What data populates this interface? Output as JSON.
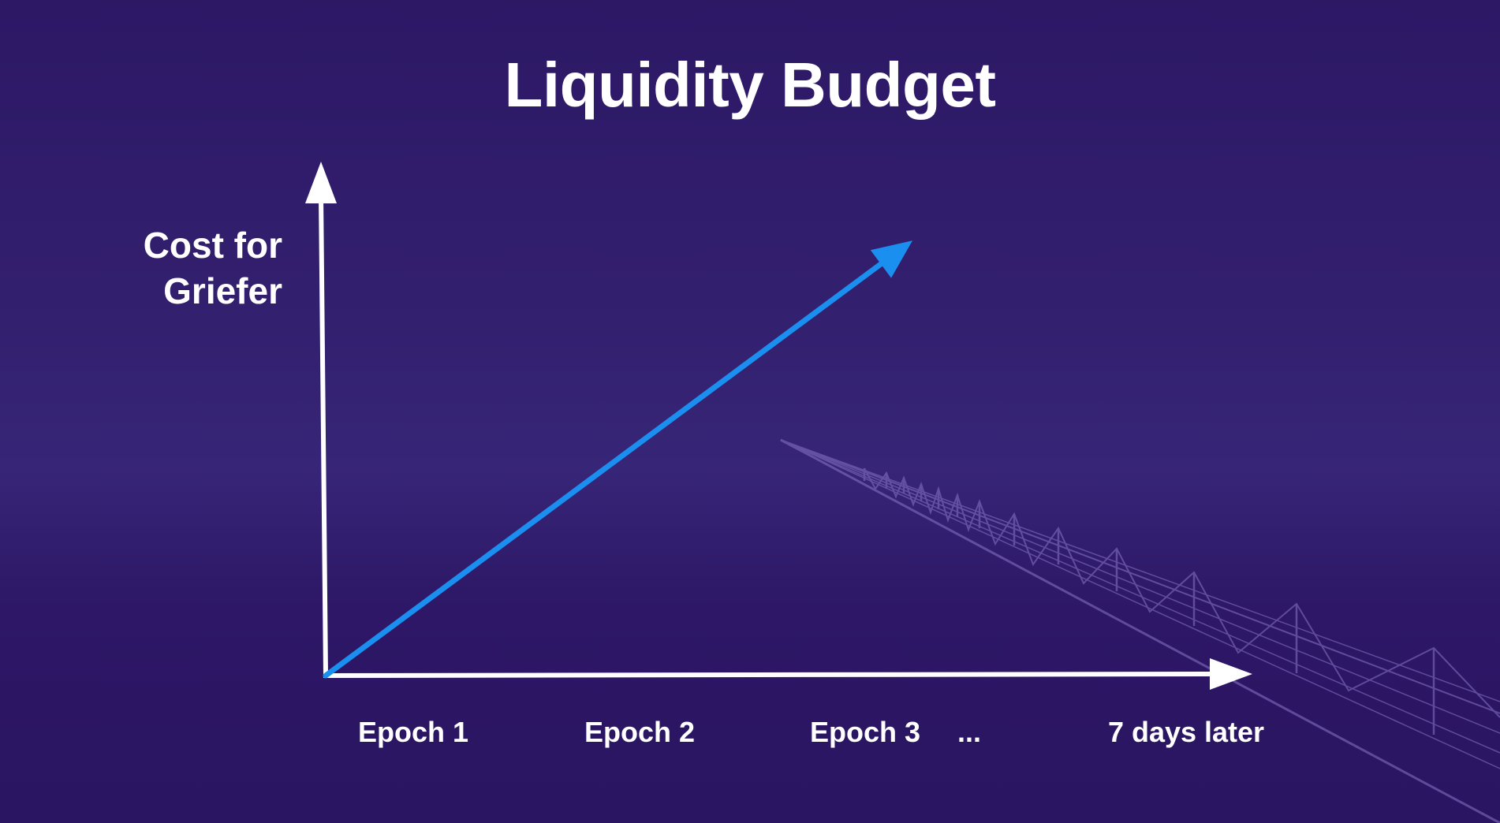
{
  "slide": {
    "title": "Liquidity Budget"
  },
  "chart_data": {
    "type": "line",
    "title": "Liquidity Budget",
    "ylabel_lines": [
      "Cost for",
      "Griefer"
    ],
    "xlabel": "",
    "categories": [
      "Epoch 1",
      "Epoch 2",
      "Epoch 3",
      "...",
      "7 days later"
    ],
    "series": [
      {
        "values": [
          0,
          1,
          2
        ]
      }
    ],
    "grid": false,
    "legend": "none",
    "colors": {
      "background": "#2e1a66",
      "axes": "#ffffff",
      "series": "#1b8ff0",
      "decoration": "#8a76c8"
    }
  }
}
